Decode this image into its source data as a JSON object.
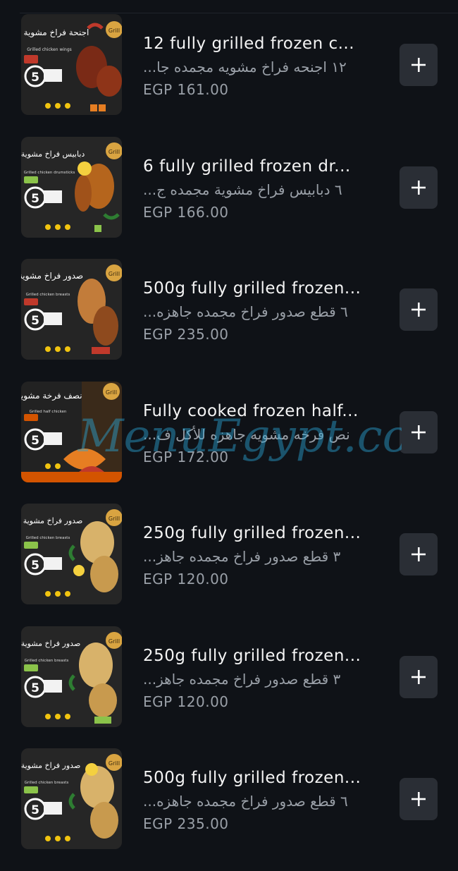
{
  "items": [
    {
      "title": "12 fully grilled frozen c...",
      "subtitle": "١٢ اجنحه فراخ مشويه مجمده جا...",
      "price": "EGP 161.00",
      "image": {
        "box_title": "اجنحة فراخ مشوية",
        "box_subtitle": "Grilled chicken wings",
        "brand": "Grill",
        "minutes": "5",
        "accent": "#c0392b"
      }
    },
    {
      "title": "6 fully grilled frozen dr...",
      "subtitle": "٦ دبابيس فراخ مشوية مجمده ج...",
      "price": "EGP 166.00",
      "image": {
        "box_title": "دبابيس فراخ مشوية",
        "box_subtitle": "Grilled chicken drumsticks",
        "brand": "Grill",
        "minutes": "5",
        "accent": "#8bc34a"
      }
    },
    {
      "title": "500g fully grilled frozen...",
      "subtitle": "٦ قطع صدور فراخ مجمده جاهزه...",
      "price": "EGP 235.00",
      "image": {
        "box_title": "صدور فراخ مشوية",
        "box_subtitle": "Grilled chicken breasts",
        "brand": "Grill",
        "minutes": "5",
        "accent": "#c0392b"
      }
    },
    {
      "title": "Fully cooked frozen half...",
      "subtitle": "نص فرخه مشويه جاهزه للأكل ف...",
      "price": "EGP 172.00",
      "image": {
        "box_title": "نصف فرخة مشوية",
        "box_subtitle": "Grilled half chicken",
        "brand": "Grill",
        "minutes": "5",
        "accent": "#d35400"
      }
    },
    {
      "title": "250g fully grilled frozen...",
      "subtitle": "٣ قطع صدور فراخ مجمده جاهز...",
      "price": "EGP 120.00",
      "image": {
        "box_title": "صدور فراخ مشوية",
        "box_subtitle": "Grilled chicken breasts",
        "brand": "Grill",
        "minutes": "5",
        "accent": "#8bc34a"
      }
    },
    {
      "title": "250g fully grilled frozen...",
      "subtitle": "٣ قطع صدور فراخ مجمده جاهز...",
      "price": "EGP 120.00",
      "image": {
        "box_title": "صدور فراخ مشوية",
        "box_subtitle": "Grilled chicken breasts",
        "brand": "Grill",
        "minutes": "5",
        "accent": "#8bc34a"
      }
    },
    {
      "title": "500g fully grilled frozen...",
      "subtitle": "٦ قطع صدور فراخ مجمده جاهزه...",
      "price": "EGP 235.00",
      "image": {
        "box_title": "صدور فراخ مشوية",
        "box_subtitle": "Grilled chicken breasts",
        "brand": "Grill",
        "minutes": "5",
        "accent": "#8bc34a"
      }
    }
  ],
  "watermark": "MenuEgypt.com",
  "icons": {
    "add": "plus-icon"
  },
  "colors": {
    "background": "#0f1217",
    "button": "#2a2e35",
    "title_text": "#f4f4f4",
    "secondary_text": "#9aa0a8",
    "watermark": "#2aa6d6"
  }
}
